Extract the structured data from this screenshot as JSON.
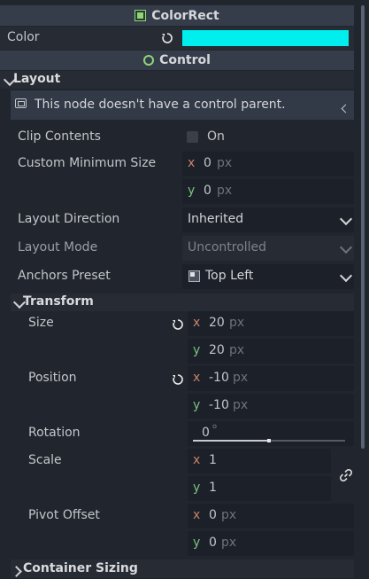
{
  "colorrect": {
    "title": "ColorRect",
    "color_label": "Color",
    "color_value": "#00eeee"
  },
  "control": {
    "title": "Control"
  },
  "layout": {
    "title": "Layout",
    "warning": "This node doesn't have a control parent.",
    "clip_contents": {
      "label": "Clip Contents",
      "value": "On"
    },
    "min_size": {
      "label": "Custom Minimum Size",
      "x_axis": "x",
      "x_value": "0",
      "x_unit": "px",
      "y_axis": "y",
      "y_value": "0",
      "y_unit": "px"
    },
    "direction": {
      "label": "Layout Direction",
      "value": "Inherited"
    },
    "mode": {
      "label": "Layout Mode",
      "value": "Uncontrolled"
    },
    "anchors": {
      "label": "Anchors Preset",
      "value": "Top Left"
    }
  },
  "transform": {
    "title": "Transform",
    "size": {
      "label": "Size",
      "x_axis": "x",
      "x_value": "20",
      "x_unit": "px",
      "y_axis": "y",
      "y_value": "20",
      "y_unit": "px"
    },
    "position": {
      "label": "Position",
      "x_axis": "x",
      "x_value": "-10",
      "x_unit": "px",
      "y_axis": "y",
      "y_value": "-10",
      "y_unit": "px"
    },
    "rotation": {
      "label": "Rotation",
      "value": "0",
      "unit": "°",
      "slider_fraction": 0.5
    },
    "scale": {
      "label": "Scale",
      "x_axis": "x",
      "x_value": "1",
      "y_axis": "y",
      "y_value": "1"
    },
    "pivot": {
      "label": "Pivot Offset",
      "x_axis": "x",
      "x_value": "0",
      "x_unit": "px",
      "y_axis": "y",
      "y_value": "0",
      "y_unit": "px"
    }
  },
  "container_sizing": {
    "title": "Container Sizing"
  },
  "colors": {
    "accent_green": "#8fd47a",
    "color_swatch": "#00eeee"
  }
}
